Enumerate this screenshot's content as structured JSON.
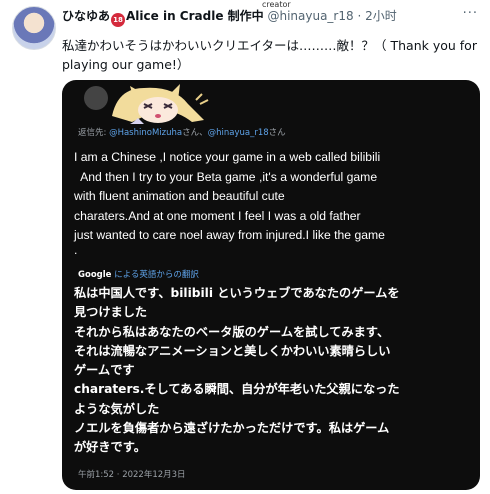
{
  "post": {
    "author_name": "ひなゆあ",
    "badge": "18",
    "author_suffix": "Alice in Cradle 制作中",
    "handle": "@hinayua_r18",
    "separator": "·",
    "time": "2小时",
    "more": "···",
    "creator_tag": "creator",
    "text": "私達かわいそうはかわいいクリエイターは………敵！？（ Thank you for playing our game!）"
  },
  "screenshot": {
    "reply_prefix": "返信先:",
    "reply_link1": "@HashinoMizuha",
    "reply_mid": "さん、",
    "reply_link2": "@hinayua_r18",
    "reply_suffix": "さん",
    "english_lines": [
      "I am a Chinese ,I notice your game in a web called bilibili",
      "  And then I try to your Beta game ,it's a wonderful game",
      "with fluent animation and beautiful cute",
      "charaters.And at one moment I feel I was a old father",
      "just wanted to care noel away from injured.I like the game",
      "."
    ],
    "google_label": "Google",
    "google_translate": "による英語からの翻訳",
    "japanese_lines": [
      "私は中国人です、bilibili というウェブであなたのゲームを",
      "見つけました",
      "それから私はあなたのベータ版のゲームを試してみます、",
      "それは流暢なアニメーションと美しくかわいい素晴らしい",
      "ゲームです",
      "charaters.そしてある瞬間、自分が年老いた父親になった",
      "ような気がした",
      "ノエルを負傷者から遠ざけたかっただけです。私はゲーム",
      "が好きです。"
    ],
    "timestamp": "午前1:52 · 2022年12月3日"
  },
  "colors": {
    "link": "#5ea2e8",
    "card_bg": "#0d0d0d",
    "badge": "#d42a3c"
  }
}
